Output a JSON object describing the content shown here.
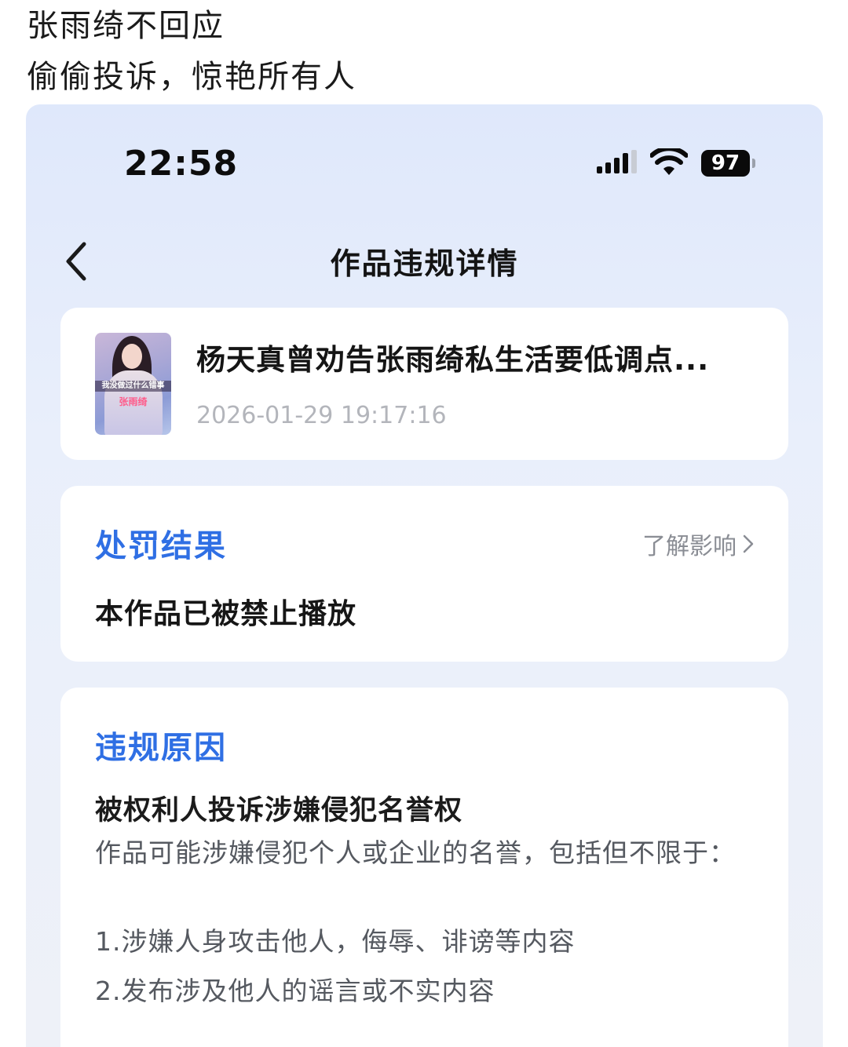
{
  "caption": {
    "line1": "张雨绮不回应",
    "line2": "偷偷投诉，惊艳所有人"
  },
  "status_bar": {
    "time": "22:58",
    "battery": "97"
  },
  "nav": {
    "title": "作品违规详情"
  },
  "work": {
    "thumbnail_caption": "我没做过什么错事",
    "thumbnail_name": "张雨绮",
    "title": "杨天真曾劝告张雨绮私生活要低调点...",
    "time": "2026-01-29 19:17:16"
  },
  "punishment": {
    "title": "处罚结果",
    "learn_more": "了解影响",
    "result": "本作品已被禁止播放"
  },
  "reason": {
    "title": "违规原因",
    "heading": "被权利人投诉涉嫌侵犯名誉权",
    "description": "作品可能涉嫌侵犯个人或企业的名誉，包括但不限于：",
    "items": [
      "1.涉嫌人身攻击他人，侮辱、诽谤等内容",
      "2.发布涉及他人的谣言或不实内容"
    ]
  },
  "colors": {
    "accent": "#2f6fe4",
    "background": "#e9effb"
  }
}
